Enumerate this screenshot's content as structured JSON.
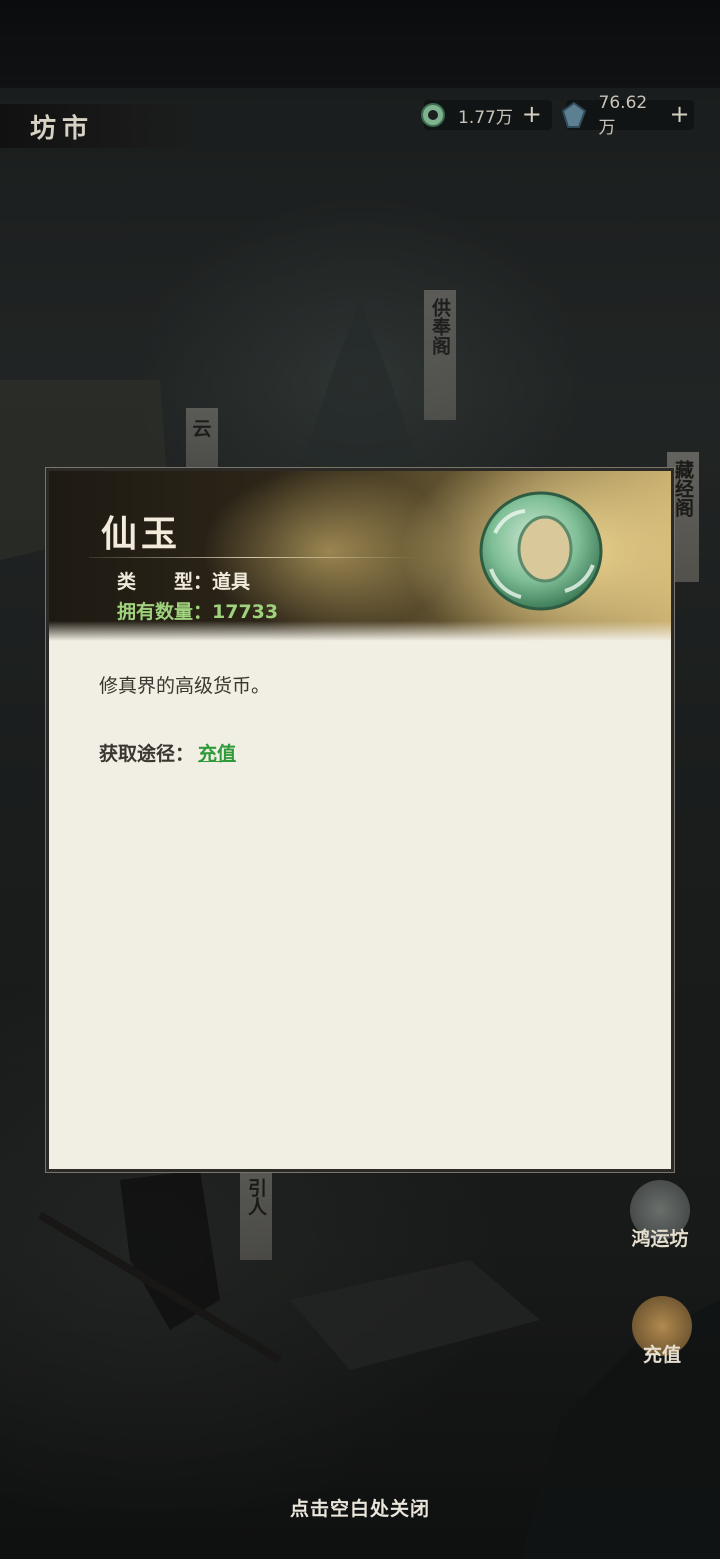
{
  "header": {
    "title": "坊市"
  },
  "currencies": [
    {
      "icon": "jade-coin-icon",
      "amount": "1.77万",
      "plus": "+"
    },
    {
      "icon": "crystal-icon",
      "amount": "76.62万",
      "plus": "+"
    }
  ],
  "scene": {
    "signs": [
      "供奉阁",
      "云",
      "藏经阁",
      "引人"
    ],
    "side_buttons": [
      {
        "label": "鸿运坊",
        "icon": "fortune-shop-icon"
      },
      {
        "label": "充值",
        "icon": "recharge-icon"
      }
    ]
  },
  "dialog": {
    "item_name": "仙玉",
    "type_label": "类　　型：",
    "type_value": "道具",
    "count_label": "拥有数量：",
    "count_value": "17733",
    "description": "修真界的高级货币。",
    "source_label": "获取途径：",
    "source_link": "充值",
    "colors": {
      "count": "#9fd27c",
      "link": "#2f9a3a"
    }
  },
  "footer": {
    "close_hint": "点击空白处关闭"
  }
}
